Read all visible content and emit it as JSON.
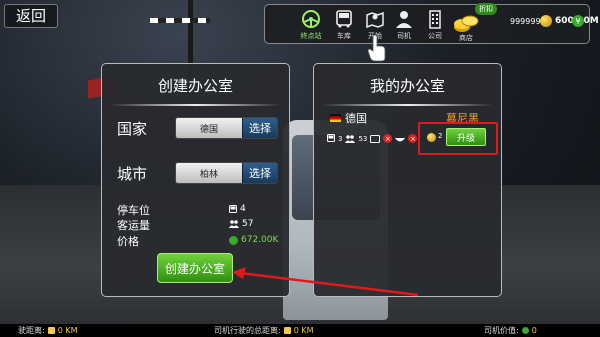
{
  "back": {
    "label": "返回"
  },
  "topbar": {
    "items": [
      {
        "label": "终点站",
        "icon": "steering-wheel-icon"
      },
      {
        "label": "车库",
        "icon": "bus-icon"
      },
      {
        "label": "开始",
        "icon": "map-icon"
      },
      {
        "label": "司机",
        "icon": "driver-icon"
      },
      {
        "label": "公司",
        "icon": "building-icon"
      }
    ],
    "sale_badge": "折扣",
    "shop_label": "商店",
    "coins": "99999999",
    "money": "600.00M"
  },
  "create_panel": {
    "title": "创建办公室",
    "country_label": "国家",
    "country_value": "德国",
    "city_label": "城市",
    "city_value": "柏林",
    "select_label": "选择",
    "stats": [
      {
        "label": "停车位",
        "value": "4"
      },
      {
        "label": "客运量",
        "value": "57"
      },
      {
        "label": "价格",
        "value": "672.00K"
      }
    ],
    "create_button": "创建办公室"
  },
  "my_office_panel": {
    "title": "我的办公室",
    "country": "德国",
    "city": "慕尼黑",
    "bus_count": "3",
    "people_count": "53",
    "upgrade_cost": "2",
    "upgrade_label": "升级"
  },
  "bottombar": {
    "distance_label": "驶距离:",
    "distance_value": "0 KM",
    "total_label": "司机行驶的总距离:",
    "total_value": "0 KM",
    "value_label": "司机价值:",
    "value_value": "0"
  },
  "colors": {
    "accent_green": "#4cb82a",
    "highlight_red": "#e01a1a",
    "city_orange": "#f2a524"
  }
}
